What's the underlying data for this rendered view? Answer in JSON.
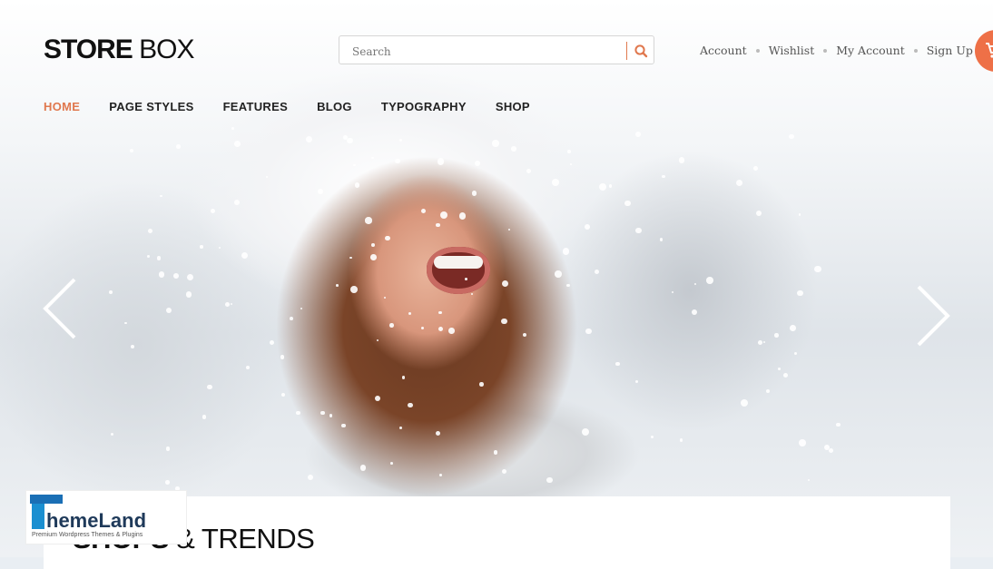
{
  "logo": {
    "bold": "STORE",
    "light": "BOX"
  },
  "search": {
    "placeholder": "Search",
    "icon": "search-icon"
  },
  "toplinks": [
    {
      "label": "Account"
    },
    {
      "label": "Wishlist"
    },
    {
      "label": "My Account"
    },
    {
      "label": "Sign Up"
    }
  ],
  "cart": {
    "icon": "cart-icon"
  },
  "nav": [
    {
      "label": "HOME",
      "active": true
    },
    {
      "label": "PAGE STYLES"
    },
    {
      "label": "FEATURES"
    },
    {
      "label": "BLOG"
    },
    {
      "label": "TYPOGRAPHY"
    },
    {
      "label": "SHOP"
    }
  ],
  "slider": {
    "prev_icon": "chevron-left-icon",
    "next_icon": "chevron-right-icon"
  },
  "section": {
    "title_bold": "SHOPS",
    "title_rest": "& TRENDS"
  },
  "watermark": {
    "brand": "iThemeLand",
    "tagline": "Premium Wordpress Themes & Plugins"
  },
  "colors": {
    "accent": "#e0784e",
    "cart": "#ee7047",
    "text": "#222222"
  }
}
